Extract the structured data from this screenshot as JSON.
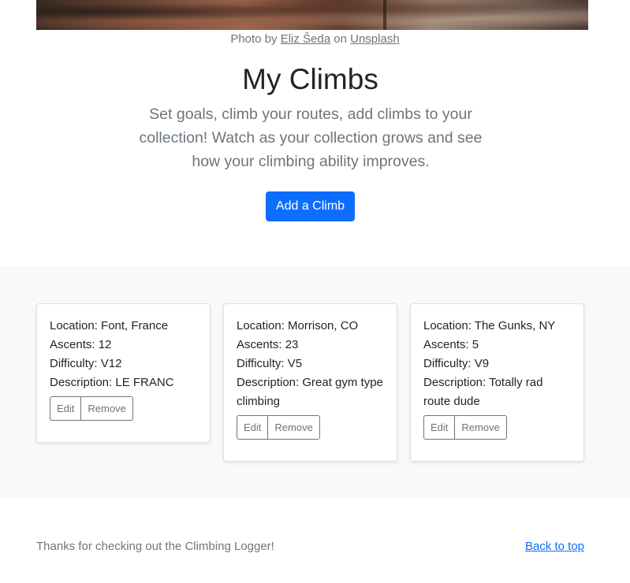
{
  "hero": {
    "credit_prefix": "Photo by",
    "credit_author": "Eliz Šeda",
    "credit_middle": "on",
    "credit_site": "Unsplash",
    "title": "My Climbs",
    "lead": "Set goals, climb your routes, add climbs to your collection! Watch as your collection grows and see how your climbing ability improves.",
    "add_button_label": "Add a Climb"
  },
  "climbs": [
    {
      "location": "Location: Font, France",
      "ascents": "Ascents: 12",
      "difficulty": "Difficulty: V12",
      "description": "Description: LE FRANC",
      "edit_label": "Edit",
      "remove_label": "Remove"
    },
    {
      "location": "Location: Morrison, CO",
      "ascents": "Ascents: 23",
      "difficulty": "Difficulty: V5",
      "description": "Description: Great gym type climbing",
      "edit_label": "Edit",
      "remove_label": "Remove"
    },
    {
      "location": "Location: The Gunks, NY",
      "ascents": "Ascents: 5",
      "difficulty": "Difficulty: V9",
      "description": "Description: Totally rad route dude",
      "edit_label": "Edit",
      "remove_label": "Remove"
    }
  ],
  "footer": {
    "thanks": "Thanks for checking out the Climbing Logger!",
    "back_to_top": "Back to top"
  },
  "colors": {
    "primary": "#0d6efd",
    "muted": "#6c757d",
    "album_bg": "#f8f9fa"
  }
}
